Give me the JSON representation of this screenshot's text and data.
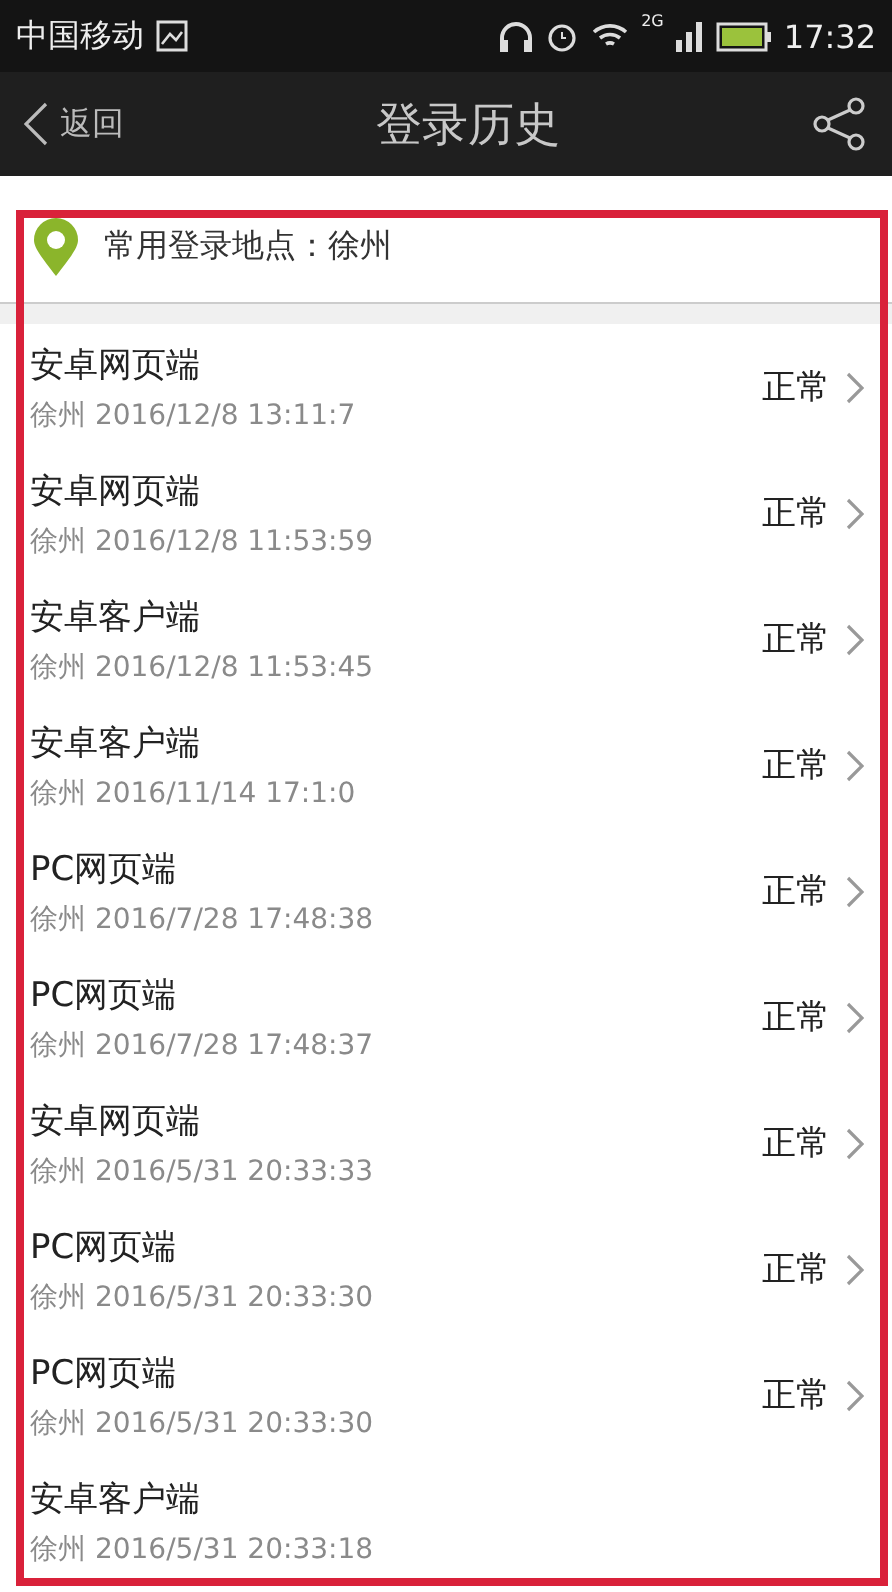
{
  "status_bar": {
    "carrier": "中国移动",
    "time": "17:32",
    "network": "2G"
  },
  "header": {
    "back": "返回",
    "title": "登录历史"
  },
  "location": {
    "label": "常用登录地点：徐州"
  },
  "records": [
    {
      "client": "安卓网页端",
      "detail": "徐州 2016/12/8 13:11:7",
      "status": "正常"
    },
    {
      "client": "安卓网页端",
      "detail": "徐州 2016/12/8 11:53:59",
      "status": "正常"
    },
    {
      "client": "安卓客户端",
      "detail": "徐州 2016/12/8 11:53:45",
      "status": "正常"
    },
    {
      "client": "安卓客户端",
      "detail": "徐州 2016/11/14 17:1:0",
      "status": "正常"
    },
    {
      "client": "PC网页端",
      "detail": "徐州 2016/7/28 17:48:38",
      "status": "正常"
    },
    {
      "client": "PC网页端",
      "detail": "徐州 2016/7/28 17:48:37",
      "status": "正常"
    },
    {
      "client": "安卓网页端",
      "detail": "徐州 2016/5/31 20:33:33",
      "status": "正常"
    },
    {
      "client": "PC网页端",
      "detail": "徐州 2016/5/31 20:33:30",
      "status": "正常"
    },
    {
      "client": "PC网页端",
      "detail": "徐州 2016/5/31 20:33:30",
      "status": "正常"
    },
    {
      "client": "安卓客户端",
      "detail": "徐州 2016/5/31 20:33:18"
    }
  ]
}
